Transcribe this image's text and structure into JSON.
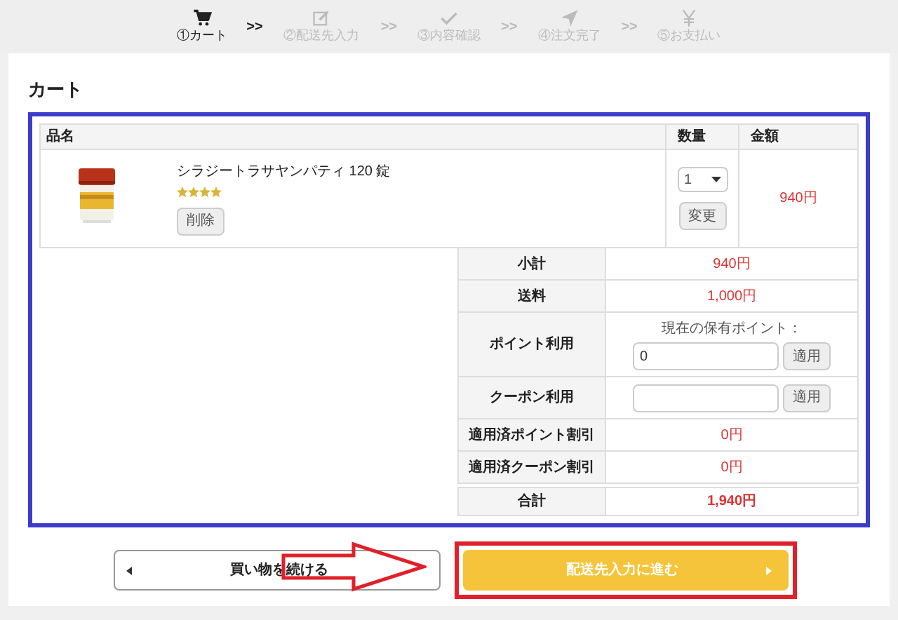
{
  "steps": [
    {
      "label": "①カート",
      "selected": true
    },
    {
      "label": "②配送先入力",
      "selected": false
    },
    {
      "label": "③内容確認",
      "selected": false
    },
    {
      "label": "④注文完了",
      "selected": false
    },
    {
      "label": "⑤お支払い",
      "selected": false
    }
  ],
  "step_separator": ">>",
  "title": "カート",
  "cart": {
    "columns": [
      "品名",
      "数量",
      "金額"
    ],
    "items": [
      {
        "name": "シラジートラサヤンパティ 120 錠",
        "stars": 4,
        "delete_button": "削除",
        "quantity": "1",
        "update_button": "変更",
        "price": "940円"
      }
    ]
  },
  "summary": [
    {
      "kind": "value",
      "label": "小計",
      "value": "940円"
    },
    {
      "kind": "value",
      "label": "送料",
      "value": "1,000円"
    },
    {
      "kind": "input",
      "label": "ポイント利用",
      "note": "現在の保有ポイント：",
      "value": "0",
      "button": "適用"
    },
    {
      "kind": "input",
      "label": "クーポン利用",
      "button": "適用"
    },
    {
      "kind": "value",
      "label": "適用済ポイント割引",
      "value": "0円"
    },
    {
      "kind": "value",
      "label": "適用済クーポン割引",
      "value": "0円"
    },
    {
      "kind": "total",
      "label": "合計",
      "value": "1,940円"
    }
  ],
  "back_button": "買い物を続ける",
  "next_button": "配送先入力に進む"
}
